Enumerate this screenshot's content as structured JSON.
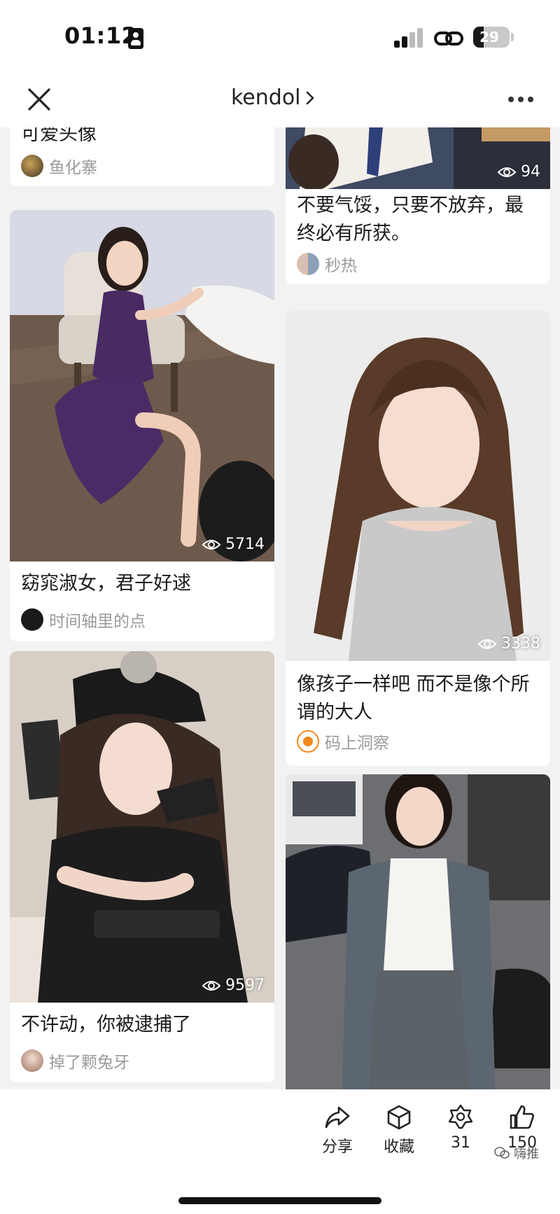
{
  "status_bar": {
    "time": "01:12",
    "battery": "29",
    "battery_level": 0.29
  },
  "nav": {
    "title": "kendol",
    "chevron": "›"
  },
  "colors": {
    "accent_orange": "#f08a1c",
    "muted_text": "#9a9a9a"
  },
  "left_column": [
    {
      "title": "可爱头像",
      "author": "鱼化寨",
      "views": ""
    },
    {
      "title": "窈窕淑女，君子好逑",
      "author": "时间轴里的点",
      "views": "5714"
    },
    {
      "title": "不许动，你被逮捕了",
      "author": "掉了颗兔牙",
      "views": "9597"
    }
  ],
  "right_column": [
    {
      "title": "不要气馁，只要不放弃，最终必有所获。",
      "author": "秒热",
      "views": "94"
    },
    {
      "title": "像孩子一样吧 而不是像个所谓的大人",
      "author": "码上洞察",
      "views": "3338"
    },
    {
      "title": "",
      "author": "",
      "views": ""
    }
  ],
  "icons": [
    "close-icon",
    "chevron-right-icon",
    "more-icon",
    "eye-icon",
    "share-icon",
    "collect-icon",
    "gem-icon",
    "like-icon"
  ],
  "actions": {
    "share": "分享",
    "collect": "收藏",
    "gem_count": "31",
    "like_count": "150"
  },
  "watermark": "嗨推"
}
